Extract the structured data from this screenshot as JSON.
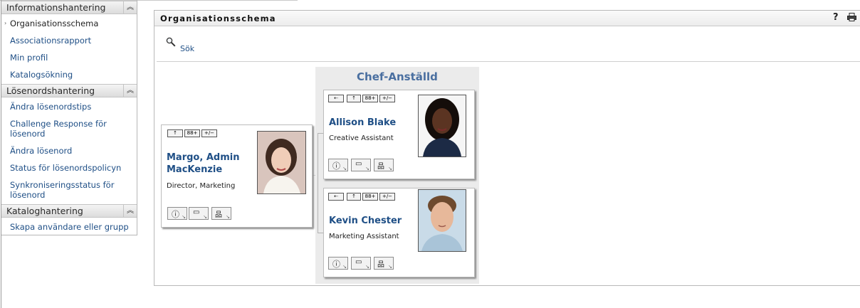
{
  "sidebar": {
    "sections": [
      {
        "title": "Informationshantering",
        "items": [
          "Organisationsschema",
          "Associationsrapport",
          "Min profil",
          "Katalogsökning"
        ]
      },
      {
        "title": "Lösenordshantering",
        "items": [
          "Ändra lösenordstips",
          "Challenge Response för lösenord",
          "Ändra lösenord",
          "Status för lösenordspolicyn",
          "Synkroniseringsstatus för lösenord"
        ]
      },
      {
        "title": "Kataloghantering",
        "items": [
          "Skapa användare eller grupp"
        ]
      }
    ],
    "selected": "Organisationsschema",
    "collapse_icon": "double-chevron-up"
  },
  "portlet": {
    "title": "Organisationsschema",
    "help_glyph": "?",
    "print_icon": "printer-icon",
    "search_label": "Sök"
  },
  "orgchart": {
    "group_label": "Chef-Anställd",
    "manager": {
      "name": "Margo, Admin MacKenzie",
      "title": "Director, Marketing",
      "toolbar": [
        "↑",
        "88+",
        "+/−"
      ]
    },
    "reports": [
      {
        "name": "Allison Blake",
        "title": "Creative Assistant",
        "toolbar": [
          "⇠",
          "↑",
          "88+",
          "+/−"
        ]
      },
      {
        "name": "Kevin Chester",
        "title": "Marketing Assistant",
        "toolbar": [
          "⇠",
          "↑",
          "88+",
          "+/−"
        ]
      }
    ],
    "action_icons": [
      "info-icon",
      "details-icon",
      "org-chart-icon"
    ]
  }
}
